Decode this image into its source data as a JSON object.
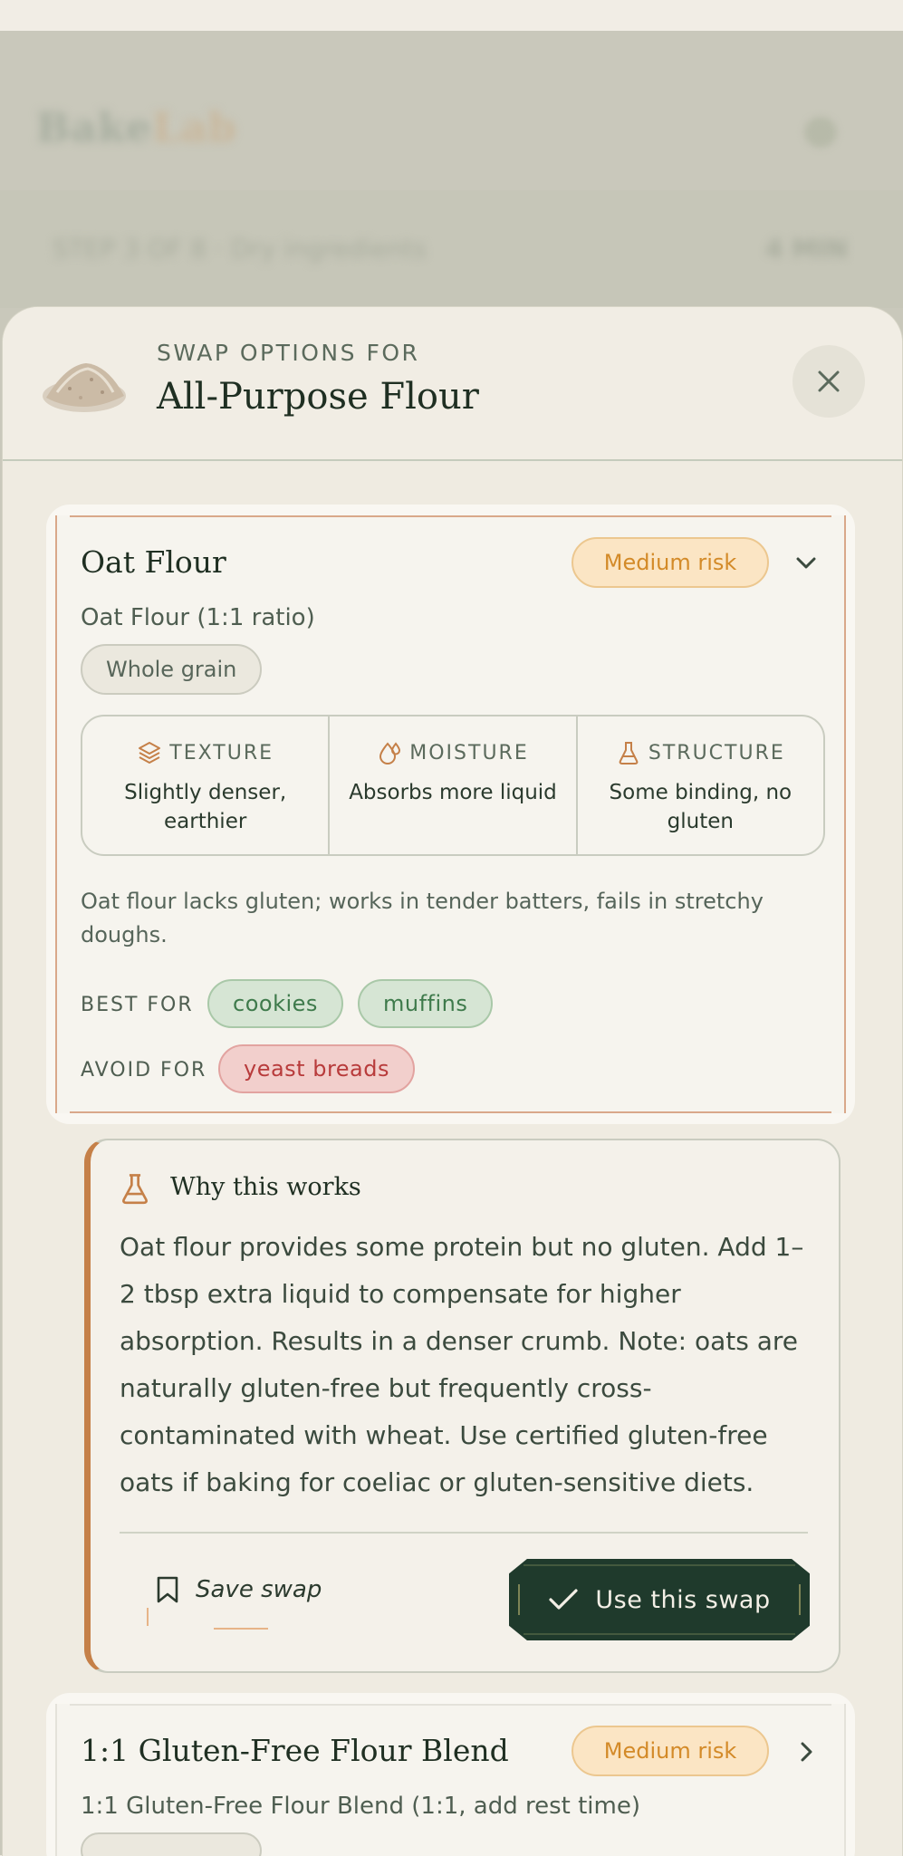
{
  "background": {
    "brand": {
      "part1": "Bake",
      "part2": "Lab"
    },
    "step_label": "STEP 3 OF 8 · Dry ingredients",
    "step_time": "4 MIN"
  },
  "sheet": {
    "kicker": "SWAP OPTIONS FOR",
    "ingredient": "All-Purpose Flour"
  },
  "option1": {
    "name": "Oat Flour",
    "risk": "Medium risk",
    "subline": "Oat Flour (1:1 ratio)",
    "tag": "Whole grain",
    "properties": [
      {
        "label": "TEXTURE",
        "value": "Slightly denser, earthier",
        "icon": "layers-icon"
      },
      {
        "label": "MOISTURE",
        "value": "Absorbs more liquid",
        "icon": "droplet-icon"
      },
      {
        "label": "STRUCTURE",
        "value": "Some binding, no gluten",
        "icon": "flask-icon"
      }
    ],
    "description": "Oat flour lacks gluten; works in tender batters, fails in stretchy doughs.",
    "best_for_label": "BEST FOR",
    "best_for": [
      "cookies",
      "muffins"
    ],
    "avoid_for_label": "AVOID FOR",
    "avoid_for": [
      "yeast breads"
    ]
  },
  "why": {
    "title": "Why this works",
    "text": "Oat flour provides some protein but no gluten. Add 1–2 tbsp extra liquid to compensate for higher absorption. Results in a denser crumb. Note: oats are naturally gluten-free but frequently cross-contaminated with wheat. Use certified gluten-free oats if baking for coeliac or gluten-sensitive diets.",
    "save_label": "Save swap",
    "use_label": "Use this swap"
  },
  "option2": {
    "name": "1:1 Gluten-Free Flour Blend",
    "risk": "Medium risk",
    "subline": "1:1 Gluten-Free Flour Blend (1:1, add rest time)"
  },
  "colors": {
    "accent": "#c58048",
    "primary_button": "#1f3a2c",
    "risk_medium": "#d38a28",
    "good": "#3e7a4b",
    "bad": "#b83b3b"
  }
}
